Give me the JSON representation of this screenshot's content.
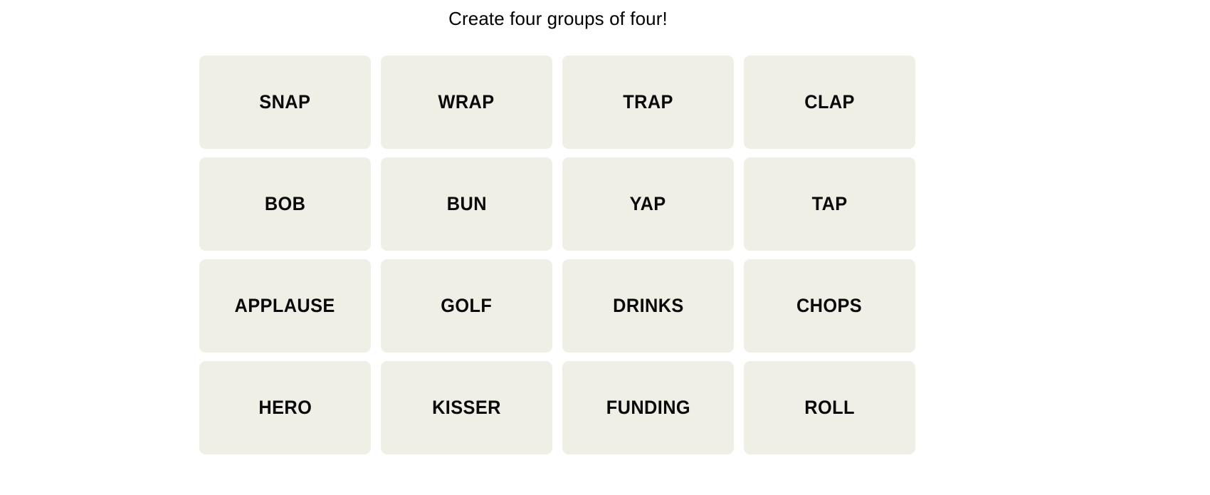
{
  "page": {
    "background_color": "#ffffff",
    "title_text": "Create four groups of four!"
  },
  "board": {
    "tile_color": "#efefe6",
    "text_color": "#0a0a0a",
    "rows": 4,
    "columns": 4,
    "tiles": [
      {
        "label": "SNAP",
        "row": 1,
        "column": 1
      },
      {
        "label": "WRAP",
        "row": 1,
        "column": 2
      },
      {
        "label": "TRAP",
        "row": 1,
        "column": 3
      },
      {
        "label": "CLAP",
        "row": 1,
        "column": 4
      },
      {
        "label": "BOB",
        "row": 2,
        "column": 1
      },
      {
        "label": "BUN",
        "row": 2,
        "column": 2
      },
      {
        "label": "YAP",
        "row": 2,
        "column": 3
      },
      {
        "label": "TAP",
        "row": 2,
        "column": 4
      },
      {
        "label": "APPLAUSE",
        "row": 3,
        "column": 1
      },
      {
        "label": "GOLF",
        "row": 3,
        "column": 2
      },
      {
        "label": "DRINKS",
        "row": 3,
        "column": 3
      },
      {
        "label": "CHOPS",
        "row": 3,
        "column": 4
      },
      {
        "label": "HERO",
        "row": 4,
        "column": 1
      },
      {
        "label": "KISSER",
        "row": 4,
        "column": 2
      },
      {
        "label": "FUNDING",
        "row": 4,
        "column": 3
      },
      {
        "label": "ROLL",
        "row": 4,
        "column": 4
      }
    ]
  }
}
